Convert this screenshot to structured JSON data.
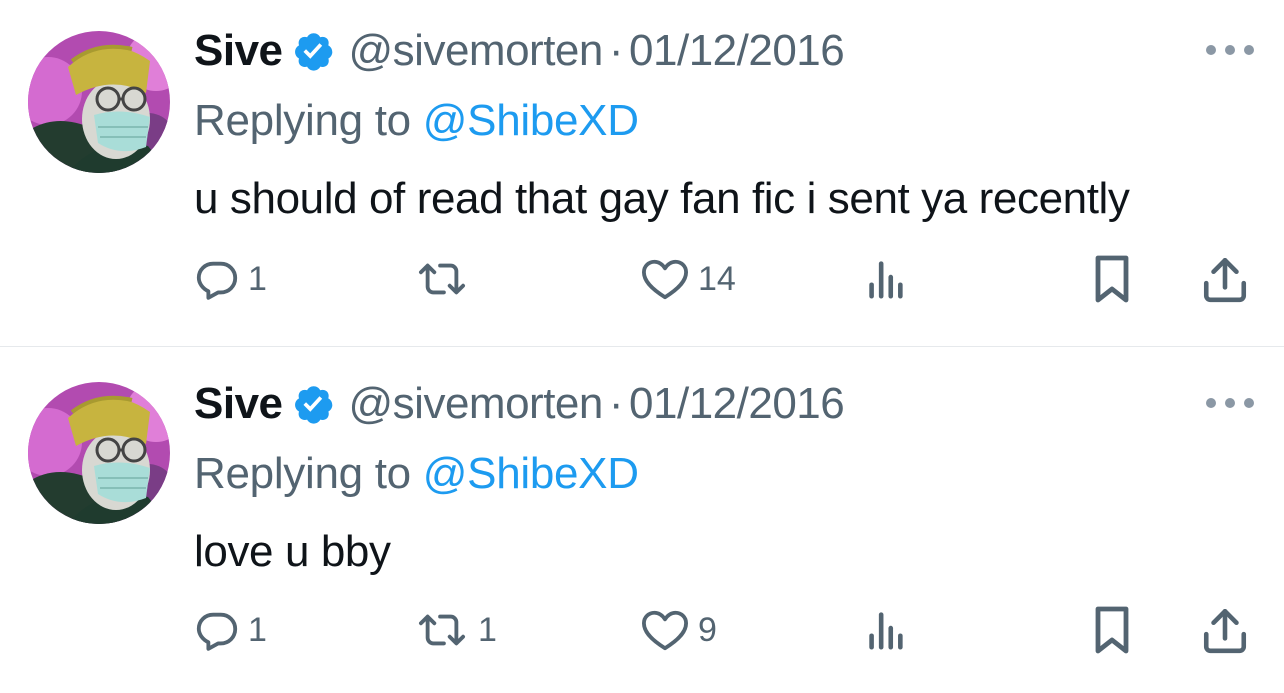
{
  "tweets": [
    {
      "display_name": "Sive",
      "handle": "@sivemorten",
      "separator": "·",
      "date": "01/12/2016",
      "replying_prefix": "Replying to",
      "replying_to": "@ShibeXD",
      "text": "u should of read that gay fan fic i sent ya recently",
      "replies": "1",
      "retweets": "",
      "likes": "14"
    },
    {
      "display_name": "Sive",
      "handle": "@sivemorten",
      "separator": "·",
      "date": "01/12/2016",
      "replying_prefix": "Replying to",
      "replying_to": "@ShibeXD",
      "text": "love u bby",
      "replies": "1",
      "retweets": "1",
      "likes": "9"
    }
  ],
  "icons": {
    "verified": "verified-badge-icon",
    "more": "more-options-icon",
    "reply": "reply-icon",
    "retweet": "retweet-icon",
    "like": "like-heart-icon",
    "views": "views-bar-chart-icon",
    "bookmark": "bookmark-icon",
    "share": "share-icon"
  },
  "colors": {
    "verified": "#1d9bf0",
    "mention": "#1d9bf0",
    "muted": "#536471",
    "text": "#0f1419",
    "divider": "#e6e9ec"
  }
}
